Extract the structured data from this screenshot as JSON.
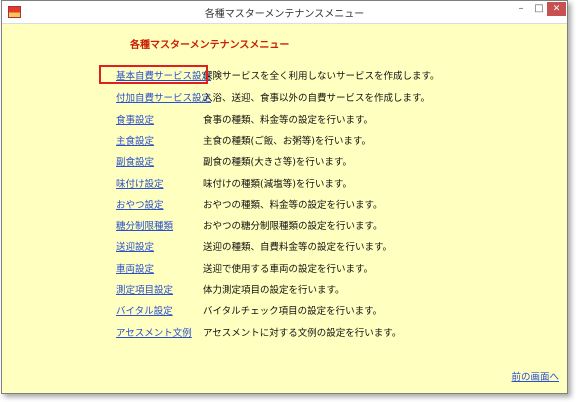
{
  "window": {
    "title": "各種マスターメンテナンスメニュー",
    "controls": {
      "minimize": "–",
      "maximize": "□",
      "close": "✕"
    }
  },
  "heading": "各種マスターメンテナンスメニュー",
  "menu": [
    {
      "label": "基本自費サービス設定",
      "description": "保険サービスを全く利用しないサービスを作成します。"
    },
    {
      "label": "付加自費サービス設定",
      "description": "入浴、送迎、食事以外の自費サービスを作成します。"
    },
    {
      "label": "食事設定",
      "description": "食事の種類、料金等の設定を行います。"
    },
    {
      "label": "主食設定",
      "description": "主食の種類(ご飯、お粥等)を行います。"
    },
    {
      "label": "副食設定",
      "description": "副食の種類(大きさ等)を行います。"
    },
    {
      "label": "味付け設定",
      "description": "味付けの種類(減塩等)を行います。"
    },
    {
      "label": "おやつ設定",
      "description": "おやつの種類、料金等の設定を行います。"
    },
    {
      "label": "糖分制限種類",
      "description": "おやつの糖分制限種類の設定を行います。"
    },
    {
      "label": "送迎設定",
      "description": "送迎の種類、自費料金等の設定を行います。"
    },
    {
      "label": "車両設定",
      "description": "送迎で使用する車両の設定を行います。"
    },
    {
      "label": "測定項目設定",
      "description": "体力測定項目の設定を行います。"
    },
    {
      "label": "バイタル設定",
      "description": "バイタルチェック項目の設定を行います。"
    },
    {
      "label": "アセスメント文例",
      "description": "アセスメントに対する文例の設定を行います。"
    }
  ],
  "back_link": "前の画面へ",
  "colors": {
    "background": "#ffffc0",
    "link": "#2a4fd0",
    "heading": "#cc1e00",
    "highlight": "#e02020"
  },
  "icons": {
    "app": "app-icon"
  }
}
